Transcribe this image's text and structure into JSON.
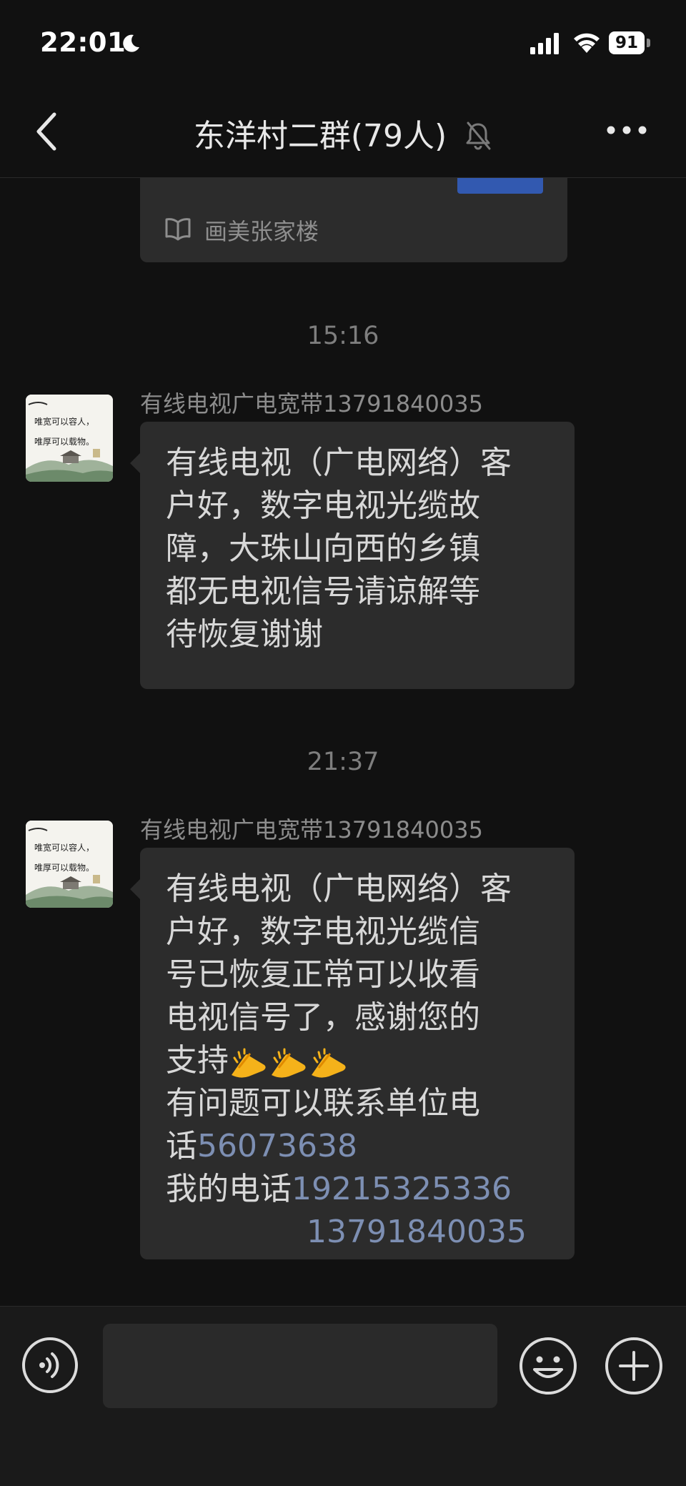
{
  "status_bar": {
    "time": "22:01",
    "battery": "91"
  },
  "header": {
    "title": "东洋村二群(79人)"
  },
  "chat": {
    "article": {
      "source": "画美张家楼"
    },
    "messages": [
      {
        "time": "15:16",
        "sender": "有线电视广电宽带13791840035",
        "lines": [
          "有线电视（广电网络）客",
          "户好，数字电视光缆故",
          "障，大珠山向西的乡镇",
          "都无电视信号请谅解等",
          "待恢复谢谢"
        ]
      },
      {
        "time": "21:37",
        "sender": "有线电视广电宽带13791840035",
        "lines": [
          "有线电视（广电网络）客",
          "户好，数字电视光缆信",
          "号已恢复正常可以收看",
          "电视信号了，感谢您的",
          "支持"
        ],
        "line6": "有问题可以联系单位电",
        "line7_prefix": "话",
        "unit_phone": "56073638",
        "line8_prefix": "我的电话",
        "my_phone_1": "19215325336",
        "my_phone_2": "13791840035"
      }
    ],
    "avatar_text": {
      "line1": "唯宽可以容人，",
      "line2": "唯厚可以载物。"
    }
  },
  "colors": {
    "background": "#111111",
    "bubble": "#2c2c2c",
    "link": "#7d8fb3",
    "input_bar": "#1a1a1a"
  },
  "icons": [
    "moon-icon",
    "signal-icon",
    "wifi-icon",
    "back-icon",
    "mute-icon",
    "more-icon",
    "book-icon",
    "clap-emoji-icon",
    "voice-icon",
    "emoji-icon",
    "add-icon"
  ]
}
